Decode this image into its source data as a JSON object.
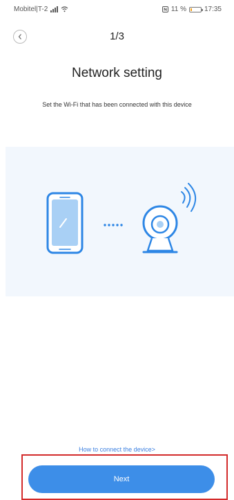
{
  "status_bar": {
    "carrier": "Mobitel|T-2",
    "battery_percent": "11 %",
    "battery_level": 0.11,
    "time": "17:35"
  },
  "nav": {
    "step": "1/3"
  },
  "content": {
    "title": "Network setting",
    "subtitle": "Set the Wi-Fi that has been connected with this device"
  },
  "footer": {
    "help_link": "How to connect the device>",
    "next_label": "Next"
  },
  "colors": {
    "accent": "#3d8ee8",
    "illustration_bg": "#f2f7fd",
    "highlight": "#d32a2a"
  }
}
